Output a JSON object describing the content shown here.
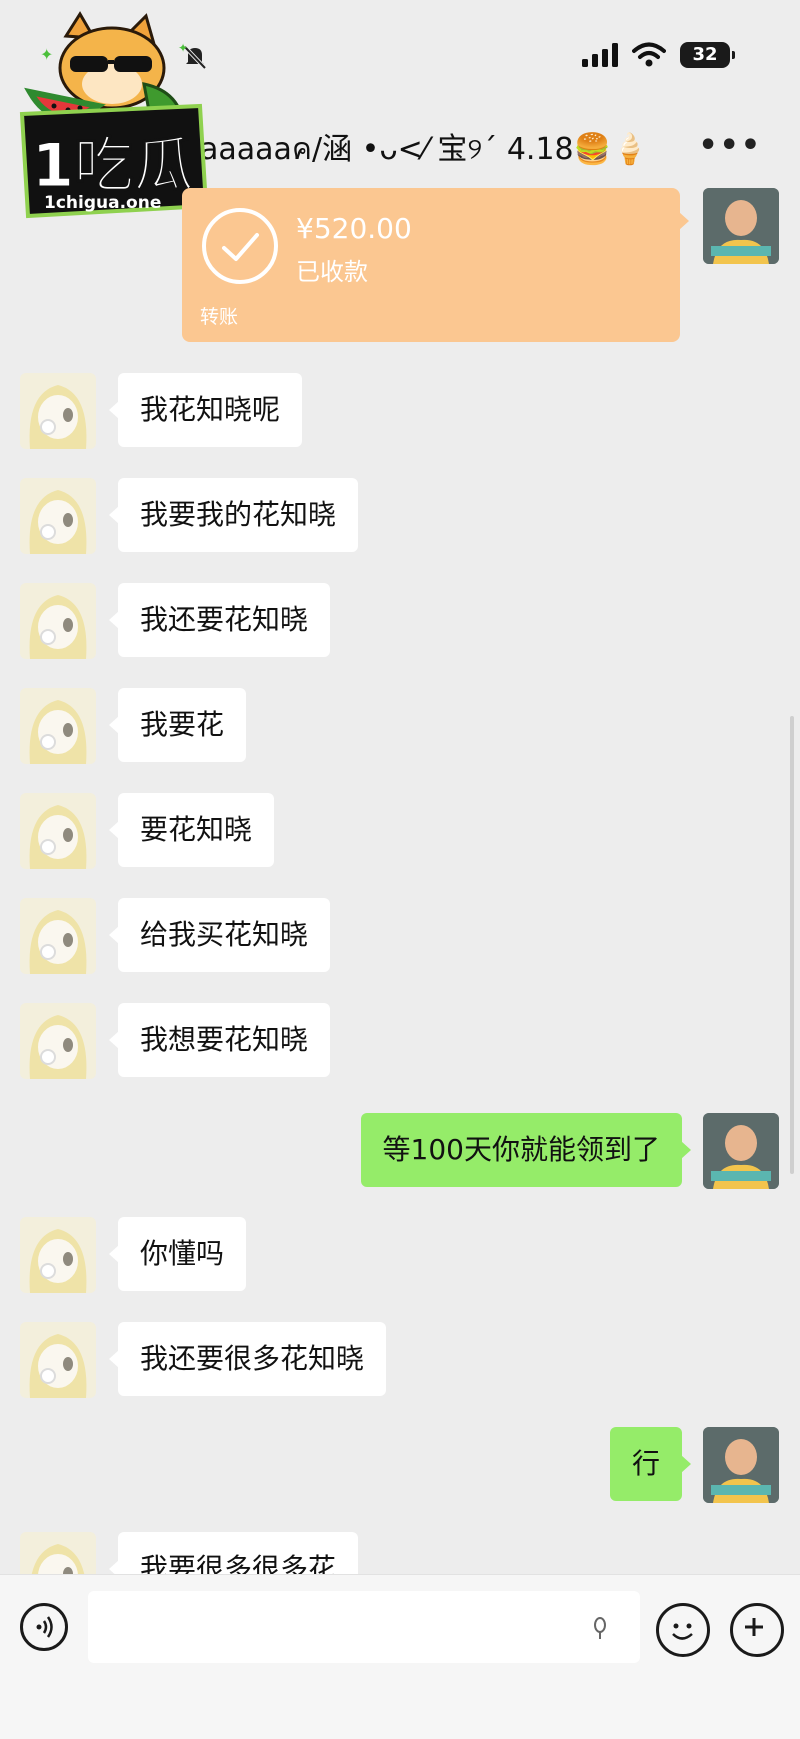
{
  "status_bar": {
    "battery": "32"
  },
  "chat": {
    "title": "aaaaaค/涵 •ᴗ<⁄ 宝୨ˊ 4.18🍔🍦"
  },
  "transfer": {
    "amount": "¥520.00",
    "status": "已收款",
    "label": "转账"
  },
  "messages": [
    {
      "side": "left",
      "text": "我花知晓呢"
    },
    {
      "side": "left",
      "text": "我要我的花知晓"
    },
    {
      "side": "left",
      "text": "我还要花知晓"
    },
    {
      "side": "left",
      "text": "我要花"
    },
    {
      "side": "left",
      "text": "要花知晓"
    },
    {
      "side": "left",
      "text": "给我买花知晓"
    },
    {
      "side": "left",
      "text": "我想要花知晓"
    },
    {
      "side": "right",
      "text": "等100天你就能领到了"
    },
    {
      "side": "left",
      "text": "你懂吗"
    },
    {
      "side": "left",
      "text": "我还要很多花知晓"
    },
    {
      "side": "right",
      "text": "行"
    },
    {
      "side": "left",
      "text": "我要很多很多花"
    }
  ],
  "watermark": {
    "brand": "1吃瓜",
    "site": "1chigua.one"
  },
  "icons": {
    "more": "more-icon",
    "voice": "voice-icon",
    "emoji": "emoji-icon",
    "plus": "plus-icon",
    "signal": "signal-icon",
    "wifi": "wifi-icon",
    "mute": "mute-bell-icon"
  },
  "colors": {
    "background": "#ededed",
    "sent_bubble": "#95ec69",
    "received_bubble": "#ffffff",
    "transfer_card": "#fbc791"
  }
}
